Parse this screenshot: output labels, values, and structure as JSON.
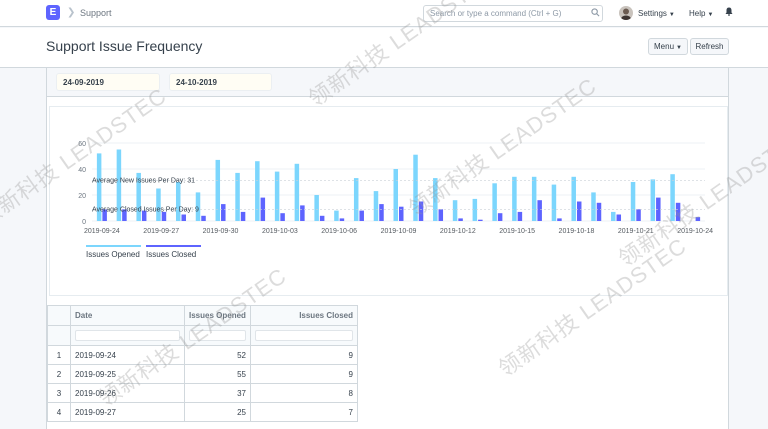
{
  "navbar": {
    "logo_letter": "E",
    "breadcrumb": "Support",
    "search_placeholder": "Search or type a command (Ctrl + G)",
    "settings_label": "Settings",
    "help_label": "Help"
  },
  "page": {
    "title": "Support Issue Frequency",
    "menu_label": "Menu",
    "refresh_label": "Refresh"
  },
  "filters": {
    "from_date": "24-09-2019",
    "to_date": "24-10-2019"
  },
  "chart_data": {
    "type": "bar",
    "categories": [
      "2019-09-24",
      "2019-09-25",
      "2019-09-26",
      "2019-09-27",
      "2019-09-28",
      "2019-09-29",
      "2019-09-30",
      "2019-10-01",
      "2019-10-02",
      "2019-10-03",
      "2019-10-04",
      "2019-10-05",
      "2019-10-06",
      "2019-10-07",
      "2019-10-08",
      "2019-10-09",
      "2019-10-10",
      "2019-10-11",
      "2019-10-12",
      "2019-10-13",
      "2019-10-14",
      "2019-10-15",
      "2019-10-16",
      "2019-10-17",
      "2019-10-18",
      "2019-10-19",
      "2019-10-20",
      "2019-10-21",
      "2019-10-22",
      "2019-10-23",
      "2019-10-24"
    ],
    "x_tick_labels": [
      "2019-09-24",
      "2019-09-27",
      "2019-09-30",
      "2019-10-03",
      "2019-10-06",
      "2019-10-09",
      "2019-10-12",
      "2019-10-15",
      "2019-10-18",
      "2019-10-21",
      "2019-10-24"
    ],
    "series": [
      {
        "name": "Issues Opened",
        "color": "#7cd6fd",
        "values": [
          52,
          55,
          37,
          25,
          30,
          22,
          47,
          37,
          46,
          38,
          44,
          20,
          8,
          33,
          23,
          40,
          51,
          33,
          16,
          17,
          29,
          34,
          34,
          28,
          34,
          22,
          7,
          30,
          32,
          36,
          0
        ]
      },
      {
        "name": "Issues Closed",
        "color": "#5e64ff",
        "values": [
          9,
          9,
          8,
          7,
          5,
          4,
          13,
          7,
          18,
          6,
          12,
          4,
          2,
          8,
          13,
          11,
          15,
          9,
          2,
          1,
          6,
          7,
          16,
          2,
          15,
          14,
          5,
          9,
          18,
          14,
          3
        ]
      }
    ],
    "ylim": [
      0,
      60
    ],
    "y_ticks": [
      0,
      20,
      40,
      60
    ],
    "annotations": [
      "Average New Issues Per Day: 31",
      "Average Closed Issues Per Day: 9"
    ],
    "avg_opened": 31,
    "avg_closed": 9,
    "grid": true,
    "legend_position": "bottom-left"
  },
  "table": {
    "columns": [
      "Date",
      "Issues Opened",
      "Issues Closed"
    ],
    "rows": [
      {
        "index": "1",
        "date": "2019-09-24",
        "opened": "52",
        "closed": "9"
      },
      {
        "index": "2",
        "date": "2019-09-25",
        "opened": "55",
        "closed": "9"
      },
      {
        "index": "3",
        "date": "2019-09-26",
        "opened": "37",
        "closed": "8"
      },
      {
        "index": "4",
        "date": "2019-09-27",
        "opened": "25",
        "closed": "7"
      }
    ]
  },
  "watermark": "领新科技 LEADSTEC"
}
